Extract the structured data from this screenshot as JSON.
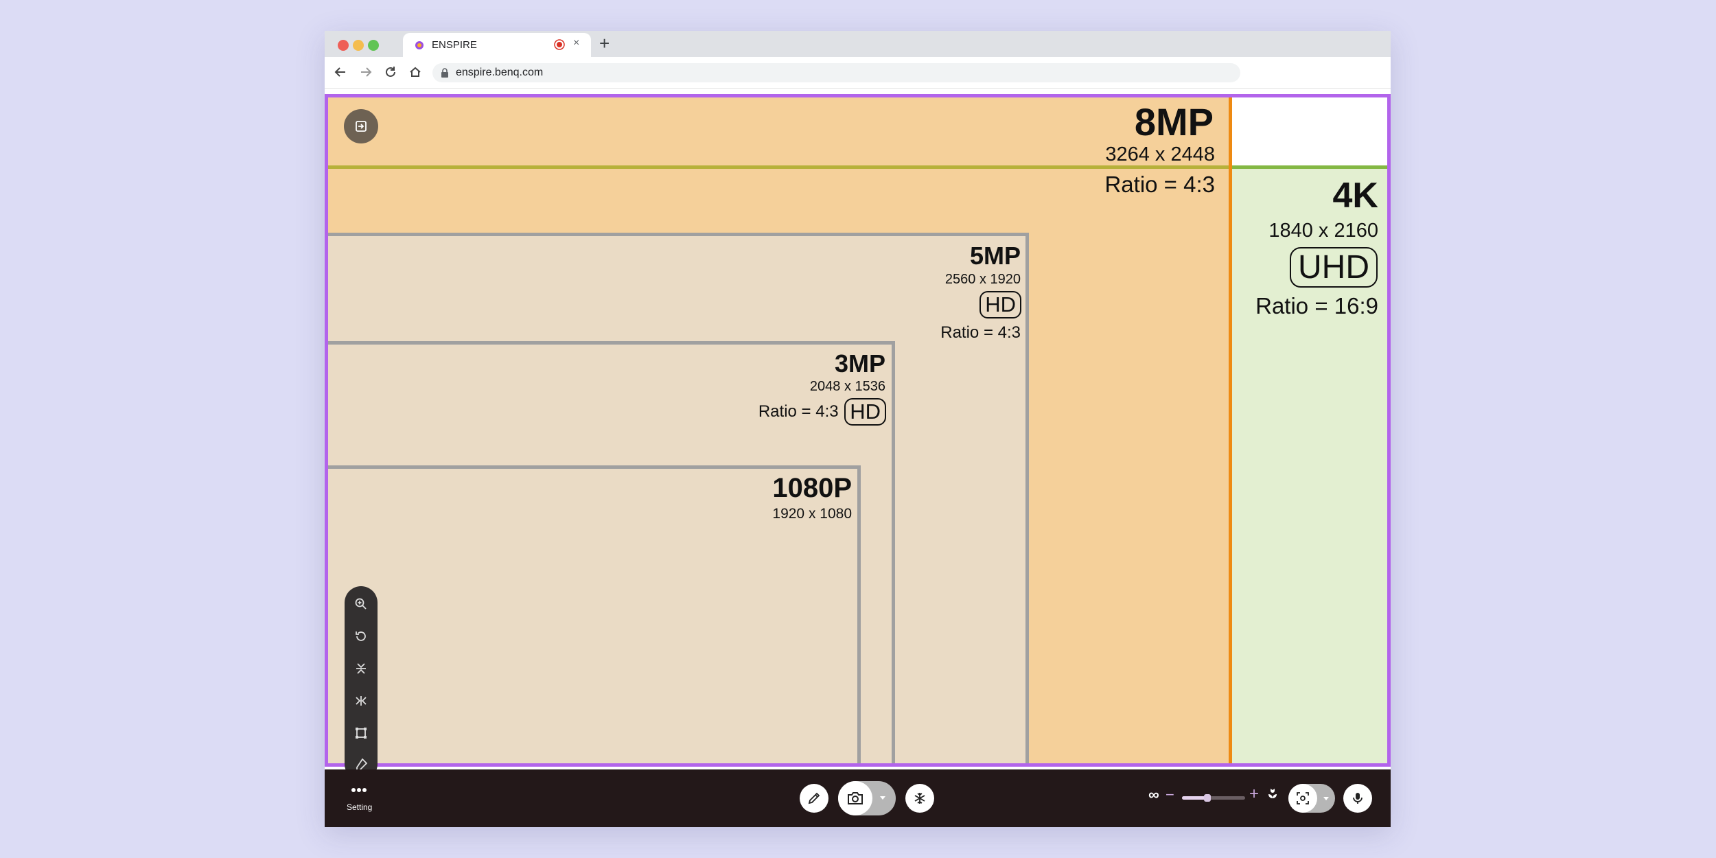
{
  "browser": {
    "tab_title": "ENSPIRE",
    "tab_close": "×",
    "new_tab": "+",
    "url": "enspire.benq.com"
  },
  "resolutions": {
    "r8mp": {
      "name": "8MP",
      "dims": "3264 x 2448",
      "ratio": "Ratio = 4:3"
    },
    "r4k": {
      "name": "4K",
      "dims": "1840 x 2160",
      "badge": "UHD",
      "ratio": "Ratio = 16:9"
    },
    "r5mp": {
      "name": "5MP",
      "dims": "2560 x 1920",
      "badge": "HD",
      "ratio": "Ratio = 4:3"
    },
    "r3mp": {
      "name": "3MP",
      "dims": "2048 x 1536",
      "badge": "HD",
      "ratio": "Ratio = 4:3"
    },
    "r1080": {
      "name": "1080P",
      "dims": "1920 x 1080"
    }
  },
  "colors": {
    "frame": "#b264eb",
    "r8mp_fill": "#f5d09a",
    "r4k_fill": "#e3efd1",
    "accent_orange": "#ee8a12",
    "bottom_bar": "#231819"
  },
  "toolbox_icons": [
    "zoom-in-icon",
    "rotate-icon",
    "flip-vertical-icon",
    "flip-horizontal-icon",
    "crop-icon",
    "eraser-icon"
  ],
  "bottombar": {
    "setting_label": "Setting",
    "zoom_infinity": "∞",
    "zoom_minus": "−",
    "zoom_plus": "+",
    "zoom_level": 0.4
  }
}
